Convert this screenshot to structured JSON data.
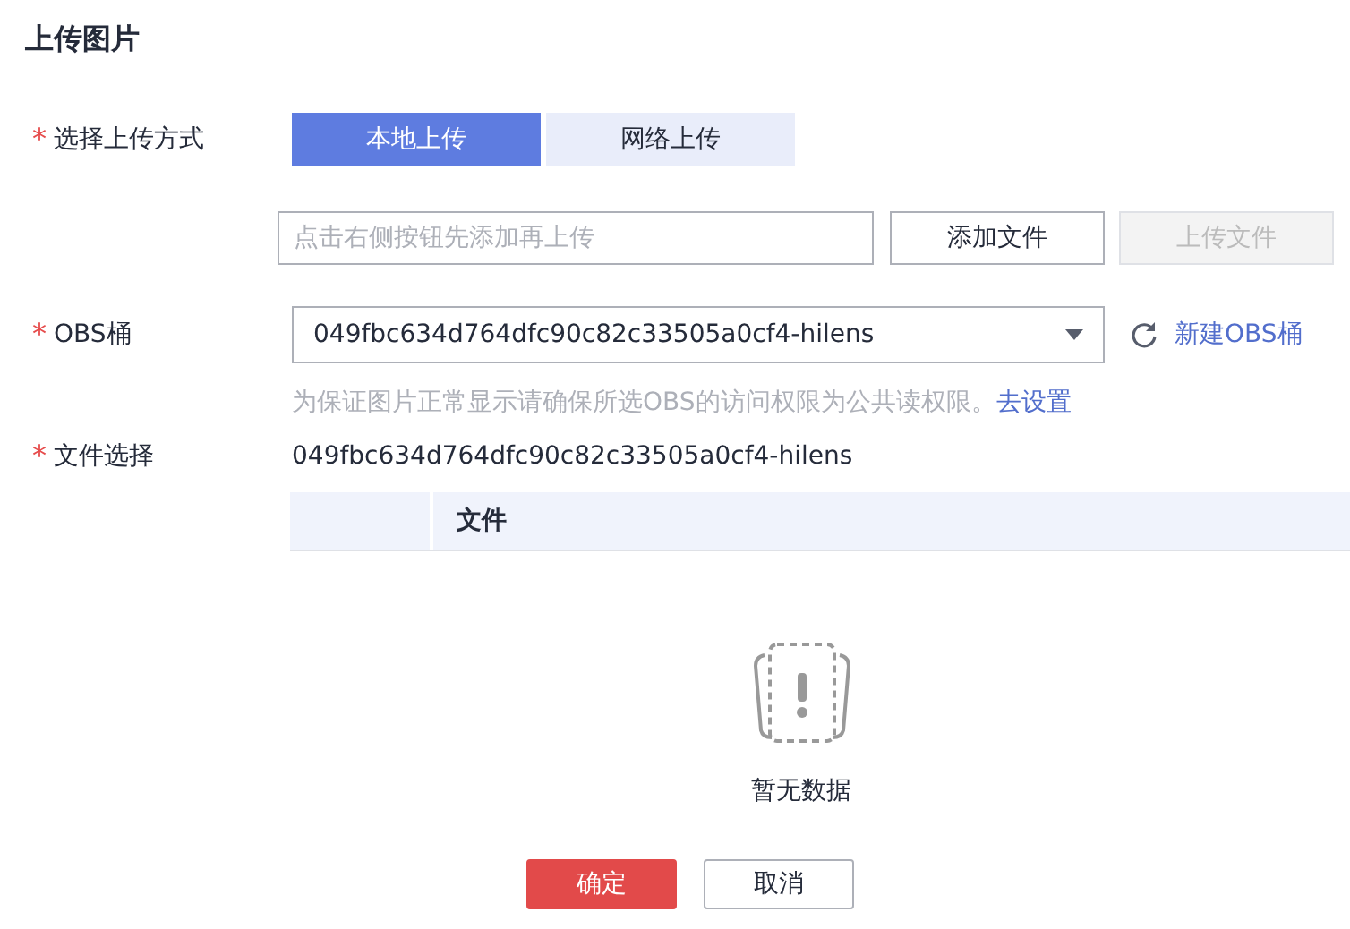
{
  "title": "上传图片",
  "upload_method": {
    "label": "选择上传方式",
    "required_mark": "*",
    "tabs": [
      {
        "label": "本地上传",
        "selected": true
      },
      {
        "label": "网络上传",
        "selected": false
      }
    ]
  },
  "file_input": {
    "placeholder": "点击右侧按钮先添加再上传",
    "buttons": [
      {
        "label": "添加文件",
        "disabled": false
      },
      {
        "label": "上传文件",
        "disabled": true
      }
    ]
  },
  "obs_bucket": {
    "label": "OBS桶",
    "required_mark": "*",
    "value": "049fbc634d764dfc90c82c33505a0cf4-hilens",
    "create_link": "新建OBS桶",
    "hint": "为保证图片正常显示请确保所选OBS的访问权限为公共读权限。",
    "hint_link": "去设置"
  },
  "file_select": {
    "label": "文件选择",
    "required_mark": "*",
    "path": "049fbc634d764dfc90c82c33505a0cf4-hilens",
    "table": {
      "columns": [
        "文件"
      ],
      "empty_text": "暂无数据"
    }
  },
  "buttons": [
    {
      "label": "确定",
      "kind": "primary"
    },
    {
      "label": "取消",
      "kind": "secondary"
    }
  ]
}
